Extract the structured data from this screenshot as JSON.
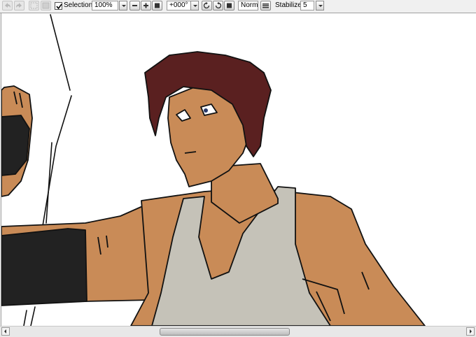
{
  "toolbar": {
    "selection_label": "Selection",
    "selection_checked": true,
    "zoom_value": "100%",
    "rotation_value": "+000°",
    "blend_mode": "Normal",
    "stabilizer_label": "Stabilizer",
    "stabilizer_value": "5"
  },
  "canvas": {
    "skin_color": "#c98b57",
    "hair_color": "#5a2020",
    "tank_color": "#c5c2b8",
    "band_color": "#222222"
  }
}
